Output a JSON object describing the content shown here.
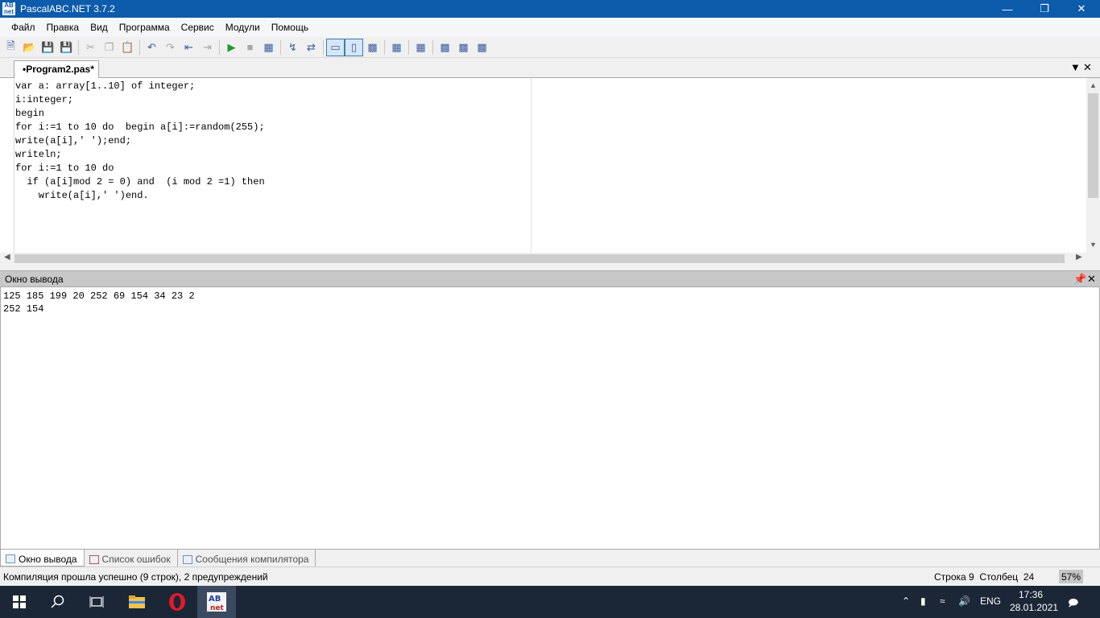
{
  "window": {
    "title": "PascalABC.NET 3.7.2",
    "app_icon_text": "AB\nnet"
  },
  "menu": [
    "Файл",
    "Правка",
    "Вид",
    "Программа",
    "Сервис",
    "Модули",
    "Помощь"
  ],
  "editor": {
    "tab_label": "•Program2.pas*",
    "lines": [
      "var a: array[1..10] of integer;",
      "i:integer;",
      "begin",
      "for i:=1 to 10 do  begin a[i]:=random(255);",
      "write(a[i],' ');end;",
      "writeln;",
      "for i:=1 to 10 do",
      "  if (a[i]mod 2 = 0) and  (i mod 2 =1) then",
      "    write(a[i],' ')end."
    ]
  },
  "output_panel": {
    "title": "Окно вывода",
    "lines": [
      "125 185 199 20 252 69 154 34 23 2",
      "252 154"
    ]
  },
  "bottom_tabs": [
    "Окно вывода",
    "Список ошибок",
    "Сообщения компилятора"
  ],
  "status": {
    "message": "Компиляция прошла успешно (9 строк), 2 предупреждений",
    "row_label": "Строка",
    "row": "9",
    "col_label": "Столбец",
    "col": "24",
    "zoom": "57%"
  },
  "taskbar": {
    "language": "ENG",
    "time": "17:36",
    "date": "28.01.2021"
  }
}
